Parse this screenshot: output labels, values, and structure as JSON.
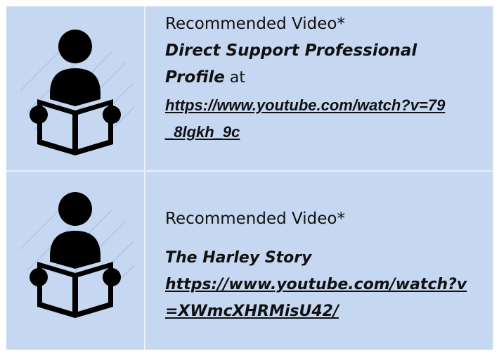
{
  "rows": [
    {
      "icon": "person-reading-book-icon",
      "heading": "Recommended Video*",
      "title_line1": "Direct Support Professional",
      "title_line2": "Profile",
      "at_text": " at",
      "url_line1": "https://www.youtube.com/watch?v=79",
      "url_line2": "_8lgkh_9c"
    },
    {
      "icon": "person-reading-book-icon",
      "heading": "Recommended Video*",
      "title": "The Harley Story",
      "url_line1": "https://www.youtube.com/watch?v",
      "url_line2": "=XWmcXHRMisU42/"
    }
  ],
  "colors": {
    "cell_background": "#c6d8f1",
    "grid_lines": "#e9f0fa",
    "icon": "#000000"
  }
}
